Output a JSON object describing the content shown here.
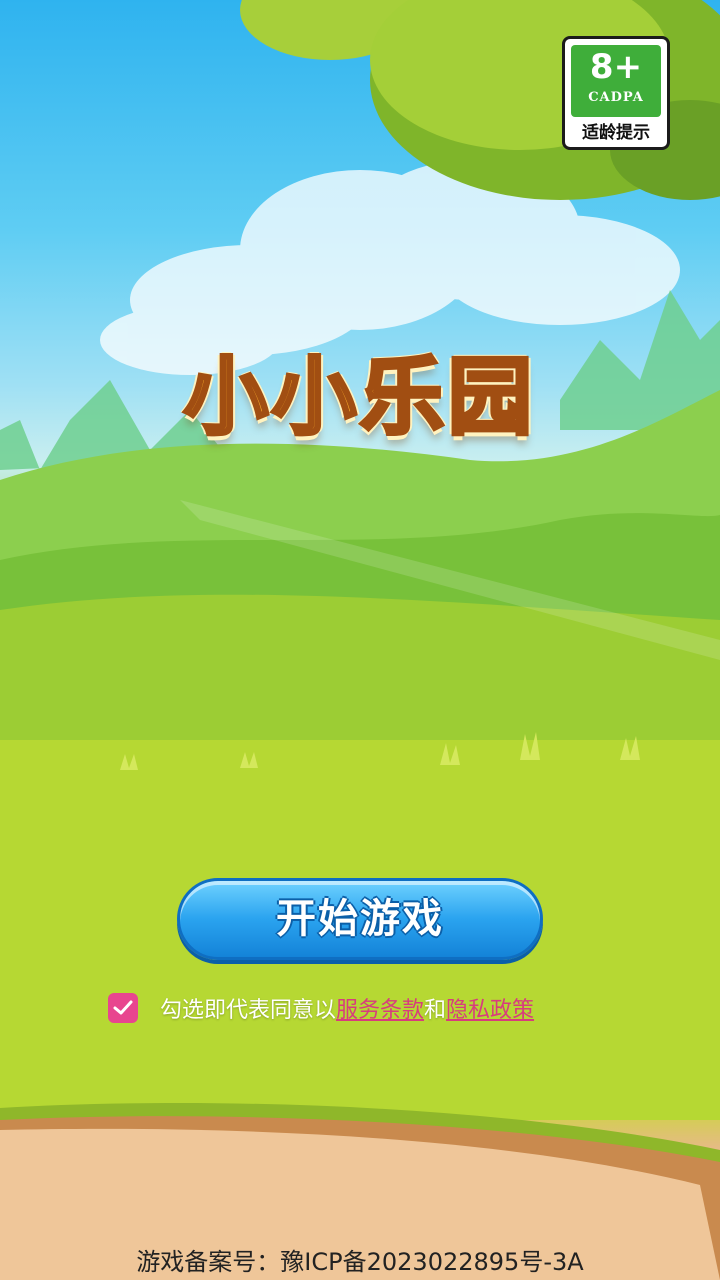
{
  "age_rating": {
    "number": "8+",
    "org": "CADPA",
    "caption": "适龄提示",
    "color": "#3fae3a"
  },
  "title": "小小乐园",
  "start_button": {
    "label": "开始游戏",
    "color": "#2aa3ef"
  },
  "agreement": {
    "checked": true,
    "prefix": "勾选即代表同意以",
    "terms_link": "服务条款",
    "joiner": "和",
    "privacy_link": "隐私政策",
    "link_color": "#d83c7d"
  },
  "footer": {
    "icp": "游戏备案号：豫ICP备2023022895号-3A"
  },
  "icons": [
    "checkmark-icon"
  ]
}
